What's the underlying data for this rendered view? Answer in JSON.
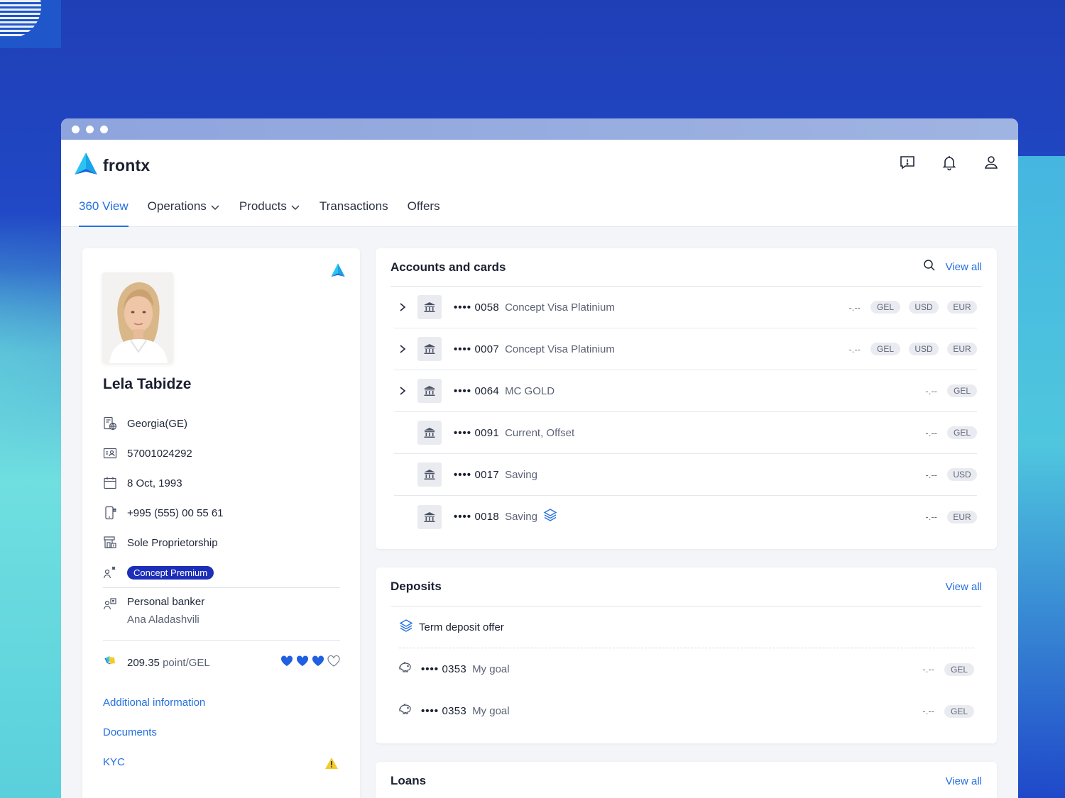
{
  "app": {
    "brand": "frontx"
  },
  "nav": {
    "items": [
      {
        "label": "360 View",
        "active": true,
        "dropdown": false
      },
      {
        "label": "Operations",
        "active": false,
        "dropdown": true
      },
      {
        "label": "Products",
        "active": false,
        "dropdown": true
      },
      {
        "label": "Transactions",
        "active": false,
        "dropdown": false
      },
      {
        "label": "Offers",
        "active": false,
        "dropdown": false
      }
    ]
  },
  "top_icons": [
    "feedback-icon",
    "bell-icon",
    "user-icon"
  ],
  "profile": {
    "name": "Lela Tabidze",
    "country": "Georgia(GE)",
    "id_number": "57001024292",
    "birth_date": "8 Oct, 1993",
    "phone": "+995 (555) 00 55 61",
    "business_type": "Sole Proprietorship",
    "segment_badge": "Concept Premium",
    "banker_label": "Personal banker",
    "banker_name": "Ana Aladashvili",
    "points_value": "209.35",
    "points_unit": "point/GEL",
    "hearts_filled": 3,
    "hearts_total": 4,
    "links": [
      "Additional information",
      "Documents",
      "KYC"
    ]
  },
  "accounts": {
    "title": "Accounts and cards",
    "view_all": "View all",
    "rows": [
      {
        "mask": "••••",
        "number": "0058",
        "name": "Concept Visa Platinium",
        "amount": "-.--",
        "currencies": [
          "GEL",
          "USD",
          "EUR"
        ],
        "expandable": true,
        "offer_icon": false
      },
      {
        "mask": "••••",
        "number": "0007",
        "name": "Concept Visa Platinium",
        "amount": "-.--",
        "currencies": [
          "GEL",
          "USD",
          "EUR"
        ],
        "expandable": true,
        "offer_icon": false
      },
      {
        "mask": "••••",
        "number": "0064",
        "name": "MC GOLD",
        "amount": "-.--",
        "currencies": [
          "GEL"
        ],
        "expandable": true,
        "offer_icon": false
      },
      {
        "mask": "••••",
        "number": "0091",
        "name": "Current, Offset",
        "amount": "-.--",
        "currencies": [
          "GEL"
        ],
        "expandable": false,
        "offer_icon": false
      },
      {
        "mask": "••••",
        "number": "0017",
        "name": "Saving",
        "amount": "-.--",
        "currencies": [
          "USD"
        ],
        "expandable": false,
        "offer_icon": false
      },
      {
        "mask": "••••",
        "number": "0018",
        "name": "Saving",
        "amount": "-.--",
        "currencies": [
          "EUR"
        ],
        "expandable": false,
        "offer_icon": true
      }
    ]
  },
  "deposits": {
    "title": "Deposits",
    "view_all": "View all",
    "offer_label": "Term deposit offer",
    "rows": [
      {
        "mask": "••••",
        "number": "0353",
        "name": "My goal",
        "amount": "-.--",
        "currency": "GEL"
      },
      {
        "mask": "••••",
        "number": "0353",
        "name": "My goal",
        "amount": "-.--",
        "currency": "GEL"
      }
    ]
  },
  "loans": {
    "title": "Loans",
    "view_all": "View all"
  },
  "colors": {
    "accent": "#2470e0",
    "badge": "#1d2fb8",
    "heart": "#1f5fe0"
  }
}
